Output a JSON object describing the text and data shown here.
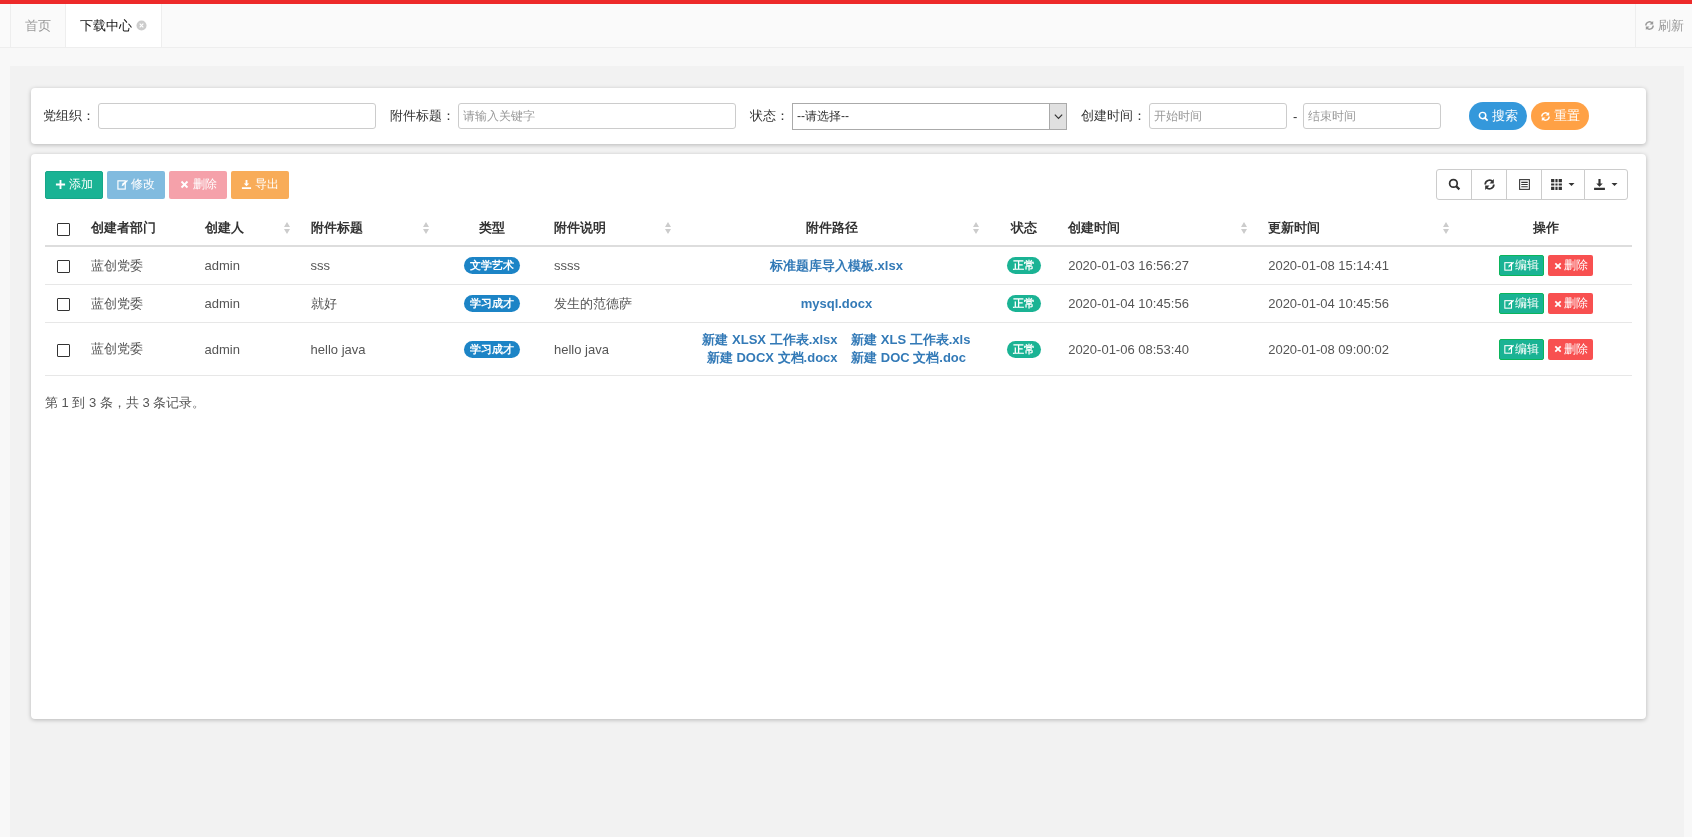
{
  "tabs": [
    {
      "label": "首页",
      "selected": false,
      "closable": false
    },
    {
      "label": "下载中心",
      "selected": true,
      "closable": true
    }
  ],
  "refresh_button": {
    "label": "刷新"
  },
  "search_form": {
    "fields": [
      {
        "kind": "text",
        "label": "党组织："
      },
      {
        "kind": "text",
        "label": "附件标题：",
        "placeholder": "请输入关键字"
      },
      {
        "kind": "select",
        "label": "状态：",
        "value": "--请选择--"
      },
      {
        "kind": "daterange",
        "label": "创建时间：",
        "start_placeholder": "开始时间",
        "separator": "-",
        "end_placeholder": "结束时间"
      }
    ],
    "buttons": [
      {
        "kind": "search",
        "label": "搜索"
      },
      {
        "kind": "reset",
        "label": "重置"
      }
    ]
  },
  "toolbar": {
    "buttons": [
      {
        "kind": "add",
        "label": "添加",
        "disabled": false
      },
      {
        "kind": "edit",
        "label": "修改",
        "disabled": true
      },
      {
        "kind": "delete",
        "label": "删除",
        "disabled": true
      },
      {
        "kind": "export",
        "label": "导出",
        "disabled": false
      }
    ]
  },
  "table": {
    "select_all": {
      "checked": false
    },
    "columns": [
      {
        "label": "创建者部门",
        "sortable": false
      },
      {
        "label": "创建人",
        "sortable": true
      },
      {
        "label": "附件标题",
        "sortable": true
      },
      {
        "label": "类型",
        "sortable": false
      },
      {
        "label": "附件说明",
        "sortable": true
      },
      {
        "label": "附件路径",
        "sortable": true
      },
      {
        "label": "状态",
        "sortable": false
      },
      {
        "label": "创建时间",
        "sortable": true
      },
      {
        "label": "更新时间",
        "sortable": true
      },
      {
        "label": "操作",
        "sortable": false
      }
    ],
    "rows": [
      {
        "checked": false,
        "department": "蓝创党委",
        "creator": "admin",
        "title": "sss",
        "type": "文学艺术",
        "description": "ssss",
        "paths": [
          "标准题库导入模板.xlsx"
        ],
        "status": "正常",
        "created": "2020-01-03 16:56:27",
        "updated": "2020-01-08 15:14:41",
        "actions": [
          {
            "kind": "edit",
            "label": "编辑"
          },
          {
            "kind": "delete",
            "label": "删除"
          }
        ]
      },
      {
        "checked": false,
        "department": "蓝创党委",
        "creator": "admin",
        "title": "就好",
        "type": "学习成才",
        "description": "发生的范德萨",
        "paths": [
          "mysql.docx"
        ],
        "status": "正常",
        "created": "2020-01-04 10:45:56",
        "updated": "2020-01-04 10:45:56",
        "actions": [
          {
            "kind": "edit",
            "label": "编辑"
          },
          {
            "kind": "delete",
            "label": "删除"
          }
        ]
      },
      {
        "checked": false,
        "department": "蓝创党委",
        "creator": "admin",
        "title": "hello java",
        "type": "学习成才",
        "description": "hello java",
        "paths": [
          "新建 XLSX 工作表.xlsx",
          "新建 XLS 工作表.xls",
          "新建 DOCX 文档.docx",
          "新建 DOC 文档.doc"
        ],
        "status": "正常",
        "created": "2020-01-06 08:53:40",
        "updated": "2020-01-08 09:00:02",
        "actions": [
          {
            "kind": "edit",
            "label": "编辑"
          },
          {
            "kind": "delete",
            "label": "删除"
          }
        ]
      }
    ]
  },
  "pagination_info": "第 1 到 3 条，共 3 条记录。"
}
